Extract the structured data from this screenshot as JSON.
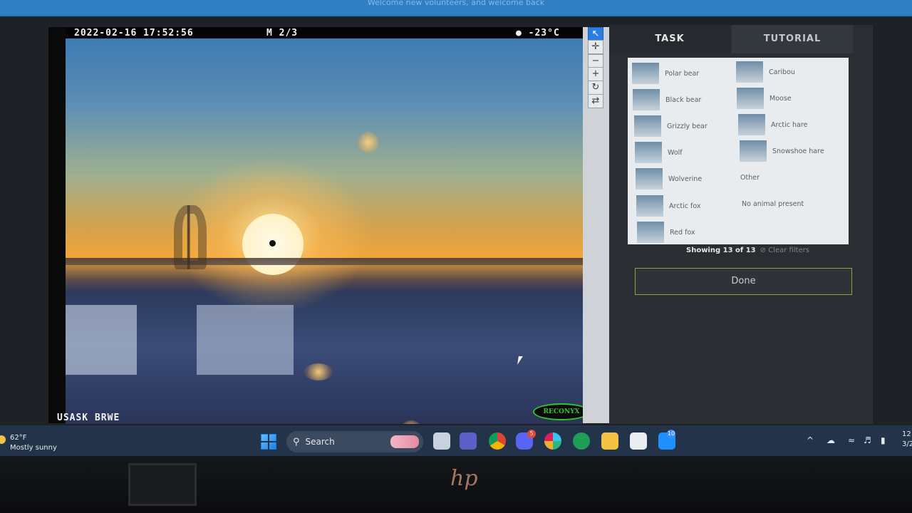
{
  "banner": {
    "text": "Welcome new volunteers, and welcome back"
  },
  "camera": {
    "timestamp": "2022-02-16 17:52:56",
    "frame": "M 2/3",
    "temperature": "●  -23°C",
    "site": "USASK BRWE",
    "brand": "RECONYX"
  },
  "tools": [
    "↖",
    "✛",
    "−",
    "+",
    "↻",
    "⇄"
  ],
  "tabs": {
    "task": "TASK",
    "tutorial": "TUTORIAL"
  },
  "choices": [
    {
      "label": "Polar bear"
    },
    {
      "label": "Caribou"
    },
    {
      "label": "Black bear"
    },
    {
      "label": "Moose"
    },
    {
      "label": "Grizzly bear"
    },
    {
      "label": "Arctic hare"
    },
    {
      "label": "Wolf"
    },
    {
      "label": "Snowshoe hare"
    },
    {
      "label": "Wolverine"
    },
    {
      "label": "Other"
    },
    {
      "label": "Arctic fox"
    },
    {
      "label": "No animal present"
    },
    {
      "label": "Red fox"
    }
  ],
  "filter": {
    "showing": "Showing 13 of 13",
    "clear": "⊘ Clear filters"
  },
  "done_label": "Done",
  "taskbar": {
    "temp": "62°F",
    "weather": "Mostly sunny",
    "search": "Search",
    "badge_discord": "5",
    "badge_store": "10",
    "clock_time": "12",
    "clock_date": "3/2"
  },
  "device": {
    "logo": "hp"
  }
}
